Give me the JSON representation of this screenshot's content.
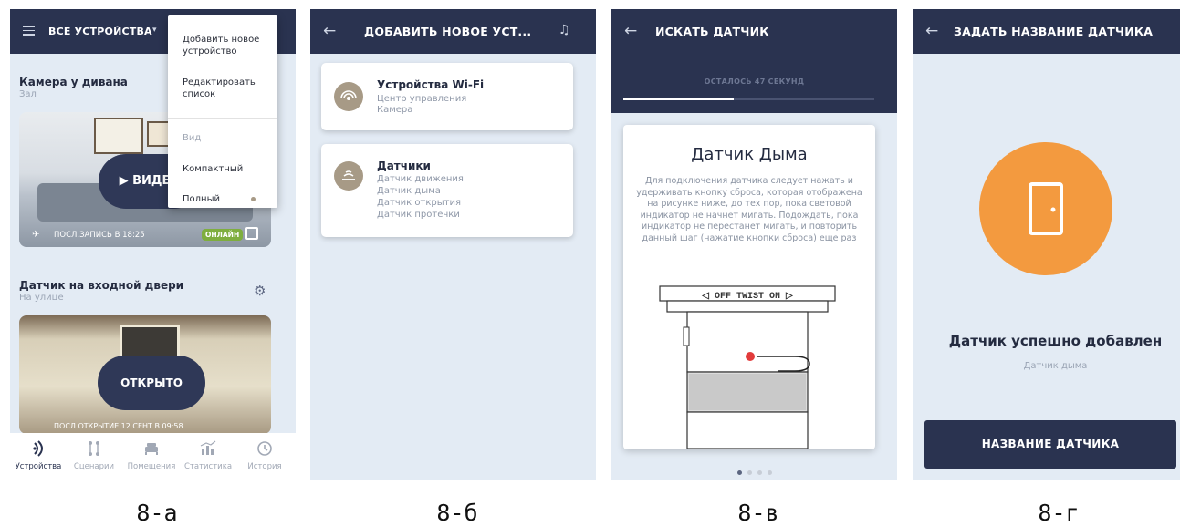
{
  "colors": {
    "navy": "#2a3350",
    "accent": "#f39a3f",
    "online": "#7fae3e",
    "background": "#e3ebf4"
  },
  "screen_a": {
    "title": "ВСЕ УСТРОЙСТВА",
    "menu": {
      "add_device": "Добавить новое устройство",
      "edit_list": "Редактировать список",
      "view_header": "Вид",
      "compact": "Компактный",
      "full": "Полный"
    },
    "device1": {
      "name": "Камера у дивана",
      "room": "Зал",
      "button": "ВИДЕО",
      "last_record": "ПОСЛ.ЗАПИСЬ В 18:25",
      "status": "ОНЛАЙН"
    },
    "device2": {
      "name": "Датчик на входной двери",
      "room": "На улице",
      "button": "ОТКРЫТО",
      "last_open": "ПОСЛ.ОТКРЫТИЕ 12 СЕНТ В 09:58"
    },
    "nav": [
      {
        "label": "Устройства",
        "icon": "devices-icon"
      },
      {
        "label": "Сценарии",
        "icon": "scenarios-icon"
      },
      {
        "label": "Помещения",
        "icon": "rooms-icon"
      },
      {
        "label": "Статистика",
        "icon": "statistics-icon"
      },
      {
        "label": "История",
        "icon": "history-icon"
      }
    ]
  },
  "screen_b": {
    "title": "ДОБАВИТЬ НОВОЕ УСТ...",
    "wifi": {
      "title": "Устройства Wi-Fi",
      "items": [
        "Центр управления",
        "Камера"
      ]
    },
    "sensors": {
      "title": "Датчики",
      "items": [
        "Датчик движения",
        "Датчик дыма",
        "Датчик открытия",
        "Датчик протечки"
      ]
    }
  },
  "screen_c": {
    "title": "ИСКАТЬ ДАТЧИК",
    "remaining": "ОСТАЛОСЬ 47 СЕКУНД",
    "progress": 0.44,
    "card_title": "Датчик Дыма",
    "card_text": "Для подключения датчика следует нажать и удерживать кнопку сброса, которая отображена на рисунке ниже, до тех пор, пока световой индикатор не начнет мигать. Подождать, пока индикатор не перестанет мигать, и повторить данный шаг (нажатие кнопки сброса) еще раз",
    "device_label": "◁ OFF TWIST ON ▷",
    "page_count": 4,
    "active_page": 1
  },
  "screen_d": {
    "title": "ЗАДАТЬ НАЗВАНИЕ ДАТЧИКА",
    "success": "Датчик успешно добавлен",
    "sensor_type": "Датчик дыма",
    "button": "НАЗВАНИЕ ДАТЧИКА"
  },
  "captions": [
    "8-а",
    "8-б",
    "8-в",
    "8-г"
  ]
}
